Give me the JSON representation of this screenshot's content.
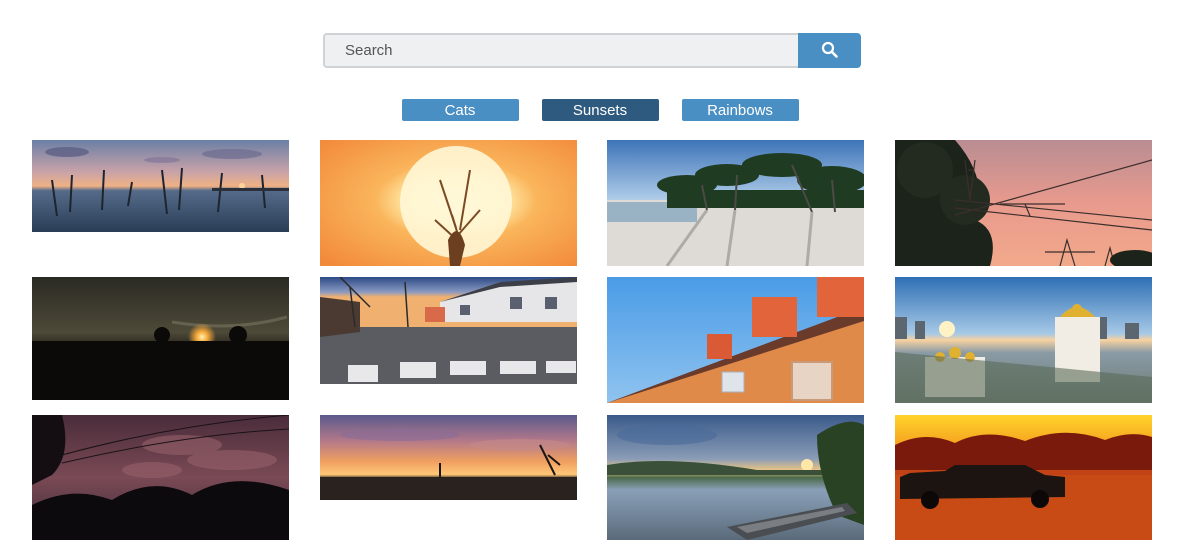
{
  "search": {
    "placeholder": "Search",
    "icon": "search-icon"
  },
  "filters": [
    {
      "label": "Cats",
      "active": false
    },
    {
      "label": "Sunsets",
      "active": true
    },
    {
      "label": "Rainbows",
      "active": false
    }
  ],
  "colors": {
    "accent": "#4a8fc4",
    "active": "#2e5a7f",
    "input_bg": "#eef0f2"
  },
  "gallery": {
    "category": "Sunsets",
    "images": [
      "lake-sunset-with-posts",
      "sun-behind-wheat",
      "palm-trees-on-beach",
      "power-lines-pink-sky",
      "sunset-over-dark-field",
      "street-crosswalk-sunset",
      "orange-house-chimneys",
      "city-cathedral-sunrise",
      "dark-clouds-over-trees",
      "orange-sky-over-lake-shore",
      "river-sunset-with-boat",
      "pickup-truck-in-red-field"
    ]
  }
}
